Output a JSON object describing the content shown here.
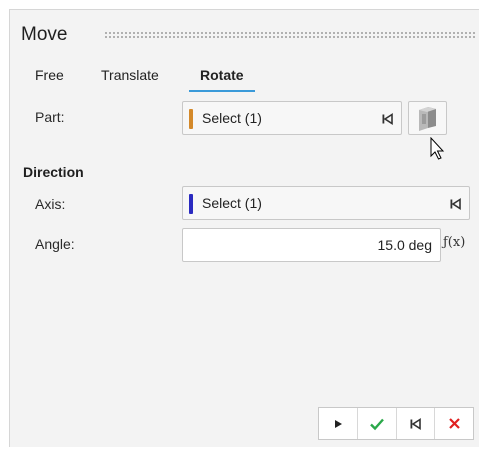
{
  "panel": {
    "title": "Move"
  },
  "tabs": [
    {
      "label": "Free",
      "active": false
    },
    {
      "label": "Translate",
      "active": false
    },
    {
      "label": "Rotate",
      "active": true
    }
  ],
  "part": {
    "label": "Part:",
    "select_text": "Select (1)",
    "color": "#d4892a"
  },
  "direction": {
    "title": "Direction",
    "axis": {
      "label": "Axis:",
      "select_text": "Select (1)",
      "color": "#2a2ac0"
    },
    "angle": {
      "label": "Angle:",
      "value": "15.0 deg",
      "function_label": "ƒ(x)"
    }
  },
  "actions": {
    "play": "play-icon",
    "confirm": "check-icon",
    "skip": "skip-back-icon",
    "cancel": "close-icon"
  },
  "colors": {
    "accent": "#3a9ad9",
    "confirm": "#2aa84a",
    "cancel": "#e02020"
  }
}
